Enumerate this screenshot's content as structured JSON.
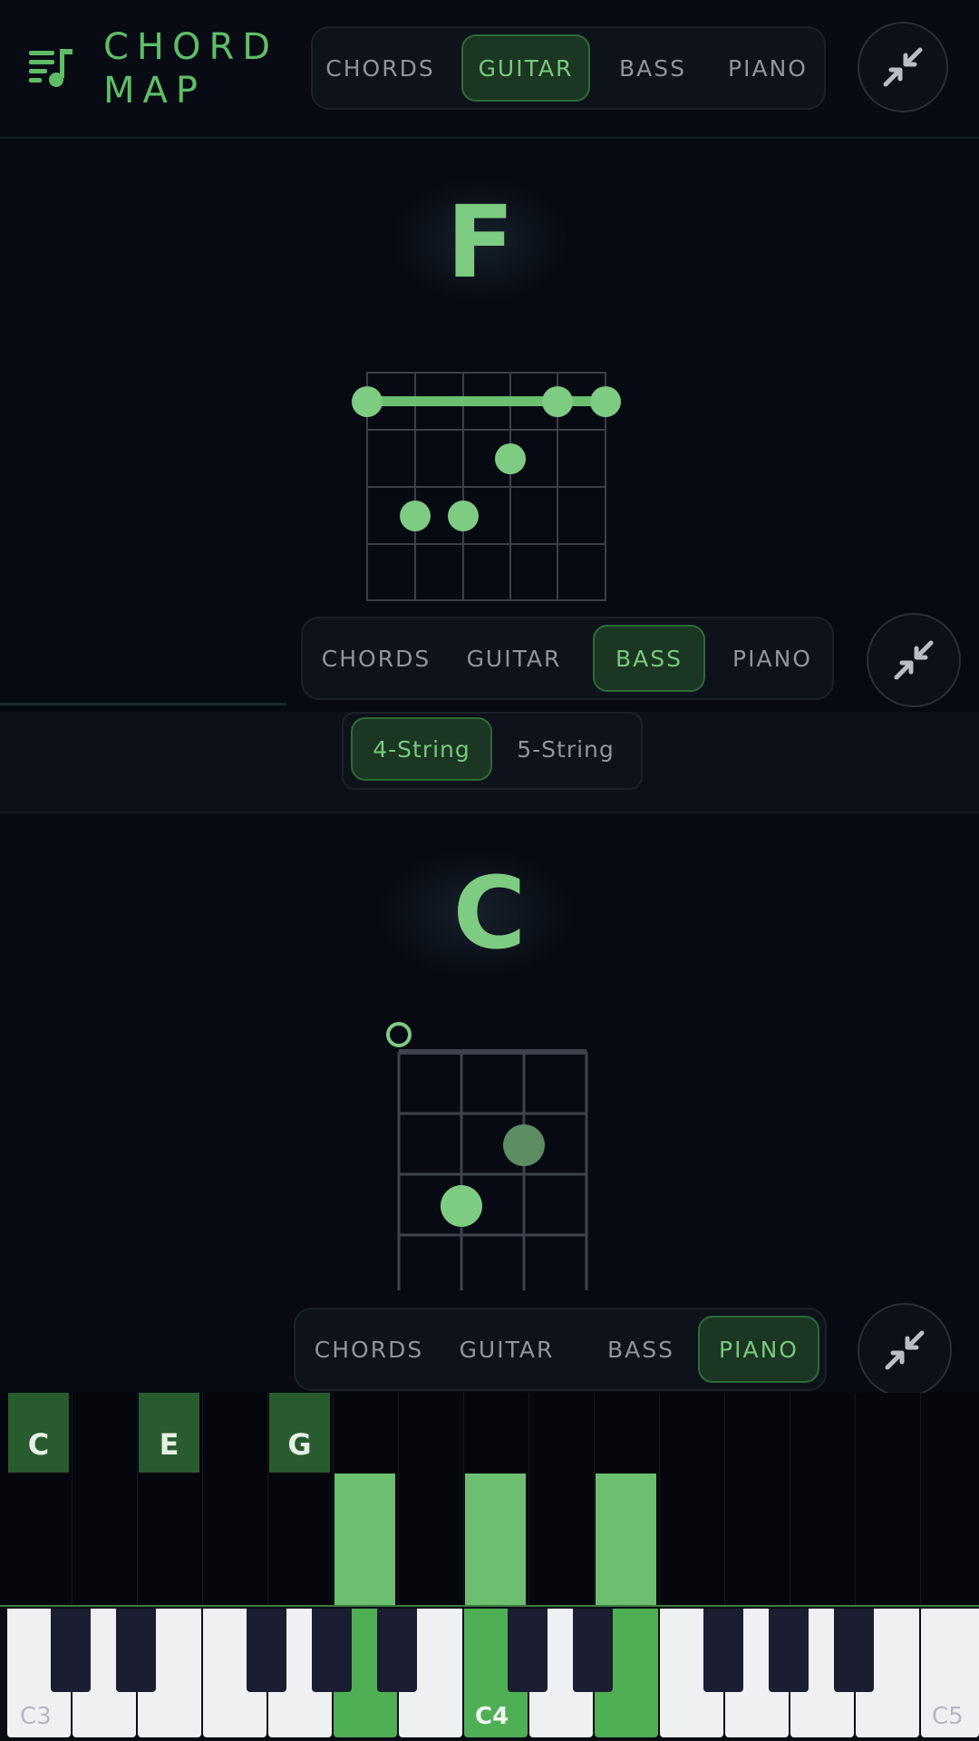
{
  "app": {
    "title_line1": "CHORD",
    "title_line2": "MAP"
  },
  "nav_tabs": [
    "CHORDS",
    "GUITAR",
    "BASS",
    "PIANO"
  ],
  "panels": [
    {
      "active_tab": "GUITAR",
      "chord": "F"
    },
    {
      "active_tab": "BASS",
      "chord": "C"
    },
    {
      "active_tab": "PIANO"
    }
  ],
  "bass_options": {
    "options": [
      "4-String",
      "5-String"
    ],
    "selected": "4-String"
  },
  "guitar_diagram": {
    "strings": 6,
    "frets_shown": 4,
    "barre_fret": 1,
    "dots": [
      {
        "string": 1,
        "fret": 1
      },
      {
        "string": 5,
        "fret": 1
      },
      {
        "string": 6,
        "fret": 1
      },
      {
        "string": 4,
        "fret": 2
      },
      {
        "string": 2,
        "fret": 3
      },
      {
        "string": 3,
        "fret": 3
      }
    ]
  },
  "bass_diagram": {
    "strings": 4,
    "frets_shown": 4,
    "open_strings": [
      1
    ],
    "dots": [
      {
        "string": 3,
        "fret": 2,
        "style": "muted"
      },
      {
        "string": 2,
        "fret": 3,
        "style": "bright"
      }
    ]
  },
  "piano": {
    "chord_notes": [
      "C",
      "E",
      "G"
    ],
    "octave_labels": [
      "C3",
      "C4",
      "C5"
    ]
  },
  "colors": {
    "accent": "#5fbd67",
    "active_bg": "#1b3623",
    "background": "#070a13",
    "key_highlight": "#4faf55"
  },
  "icons": {
    "logo": "music-playlist-icon",
    "collapse": "collapse-arrows-icon"
  }
}
